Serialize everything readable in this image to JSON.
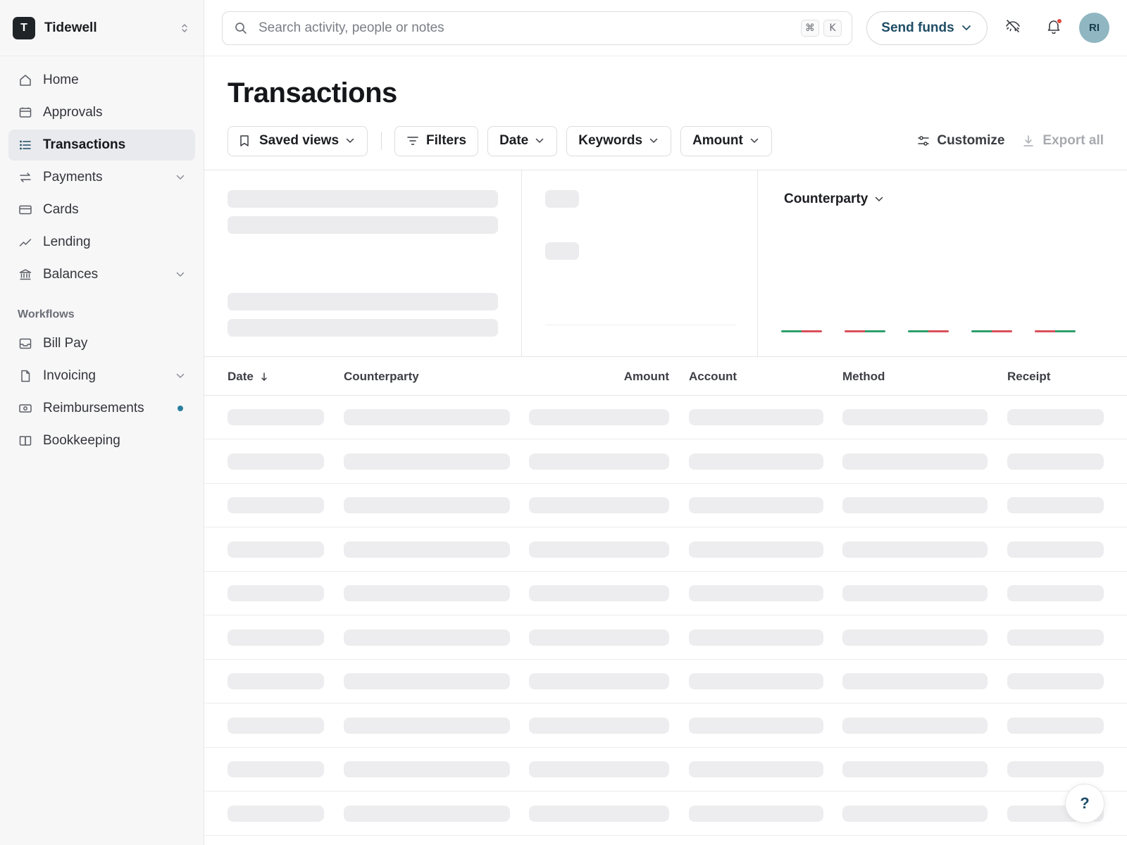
{
  "org": {
    "initial": "T",
    "name": "Tidewell"
  },
  "sidebar": {
    "items": [
      {
        "label": "Home",
        "icon": "home-icon"
      },
      {
        "label": "Approvals",
        "icon": "inbox-icon"
      },
      {
        "label": "Transactions",
        "icon": "list-icon",
        "active": true
      },
      {
        "label": "Payments",
        "icon": "transfer-icon",
        "expandable": true
      },
      {
        "label": "Cards",
        "icon": "card-icon"
      },
      {
        "label": "Lending",
        "icon": "trend-icon"
      },
      {
        "label": "Balances",
        "icon": "bank-icon",
        "expandable": true
      }
    ],
    "workflows_label": "Workflows",
    "workflow_items": [
      {
        "label": "Bill Pay",
        "icon": "tray-icon"
      },
      {
        "label": "Invoicing",
        "icon": "document-icon",
        "expandable": true
      },
      {
        "label": "Reimbursements",
        "icon": "cash-icon",
        "has_dot": true
      },
      {
        "label": "Bookkeeping",
        "icon": "book-icon"
      }
    ]
  },
  "search": {
    "placeholder": "Search activity, people or notes",
    "value": "",
    "shortcut_keys": [
      "⌘",
      "K"
    ]
  },
  "topbar": {
    "send_label": "Send funds",
    "avatar_initials": "RI",
    "has_notification": true
  },
  "page": {
    "title": "Transactions"
  },
  "toolbar": {
    "saved_views": "Saved views",
    "filters": "Filters",
    "date": "Date",
    "keywords": "Keywords",
    "amount": "Amount",
    "customize": "Customize",
    "export": "Export all"
  },
  "summary": {
    "counterparty_label": "Counterparty"
  },
  "table": {
    "columns": {
      "date": "Date",
      "counterparty": "Counterparty",
      "amount": "Amount",
      "account": "Account",
      "method": "Method",
      "receipt": "Receipt"
    },
    "sort": "descending",
    "loading_rows": 10
  },
  "help": {
    "label": "?"
  },
  "colors": {
    "accent": "#1f4d66",
    "avatar": "#8fb6c1",
    "notification": "#e14a3b",
    "positive": "#2f9e6e",
    "negative": "#d9505a",
    "skeleton": "#ececee"
  }
}
